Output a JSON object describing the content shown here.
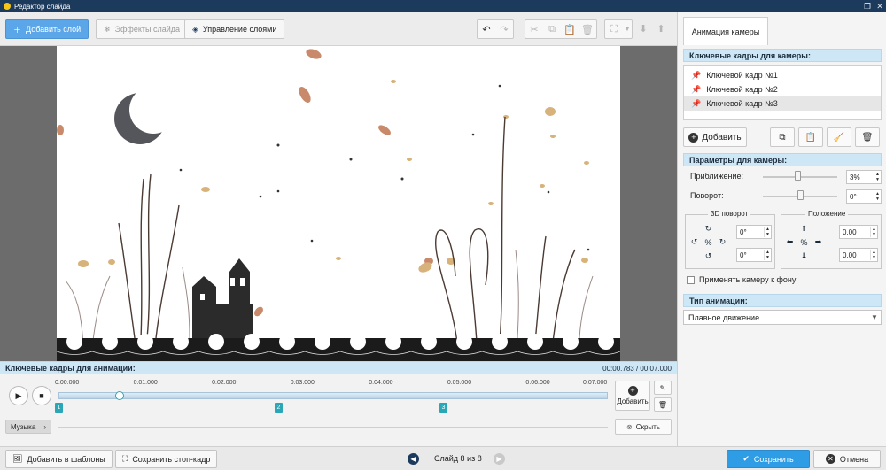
{
  "window": {
    "title": "Редактор слайда"
  },
  "toolbar": {
    "add_layer": "Добавить слой",
    "slide_effects": "Эффекты слайда",
    "manage_layers": "Управление слоями"
  },
  "panel": {
    "tab": "Анимация камеры",
    "keyframes_header": "Ключевые кадры для камеры:",
    "keyframes": [
      {
        "label": "Ключевой кадр №1",
        "selected": false
      },
      {
        "label": "Ключевой кадр №2",
        "selected": false
      },
      {
        "label": "Ключевой кадр №3",
        "selected": true
      }
    ],
    "add_label": "Добавить",
    "params_header": "Параметры для камеры:",
    "zoom_label": "Приближение:",
    "zoom_value": "3%",
    "zoom_level": 0.47,
    "rotation_label": "Поворот:",
    "rotation_value": "0°",
    "rotation_level": 0.5,
    "rotate3d_title": "3D поворот",
    "rotate3d_x": "0°",
    "rotate3d_y": "0°",
    "position_title": "Положение",
    "position_x": "0.00",
    "position_y": "0.00",
    "apply_bg_label": "Применять камеру к фону",
    "anim_type_header": "Тип анимации:",
    "anim_type_value": "Плавное движение"
  },
  "timeline": {
    "header": "Ключевые кадры для анимации:",
    "time": "00:00.783 / 00:07.000",
    "ticks": [
      "0:00.000",
      "0:01.000",
      "0:02.000",
      "0:03.000",
      "0:04.000",
      "0:05.000",
      "0:06.000",
      "0:07.000"
    ],
    "playhead_fraction": 0.112,
    "keyframes": [
      {
        "label": "1",
        "time_s": 0.0
      },
      {
        "label": "2",
        "time_s": 2.8
      },
      {
        "label": "3",
        "time_s": 4.9
      }
    ],
    "add_label": "Добавить",
    "music_label": "Музыка",
    "hide_label": "Скрыть"
  },
  "bottom": {
    "add_template": "Добавить в шаблоны",
    "save_frame": "Сохранить стоп-кадр",
    "slide_counter": "Слайд 8 из 8",
    "save": "Сохранить",
    "cancel": "Отмена"
  },
  "colors": {
    "accent": "#2f9de6",
    "header_bg": "#cde7f6",
    "keyframe": "#2aa7b6"
  }
}
